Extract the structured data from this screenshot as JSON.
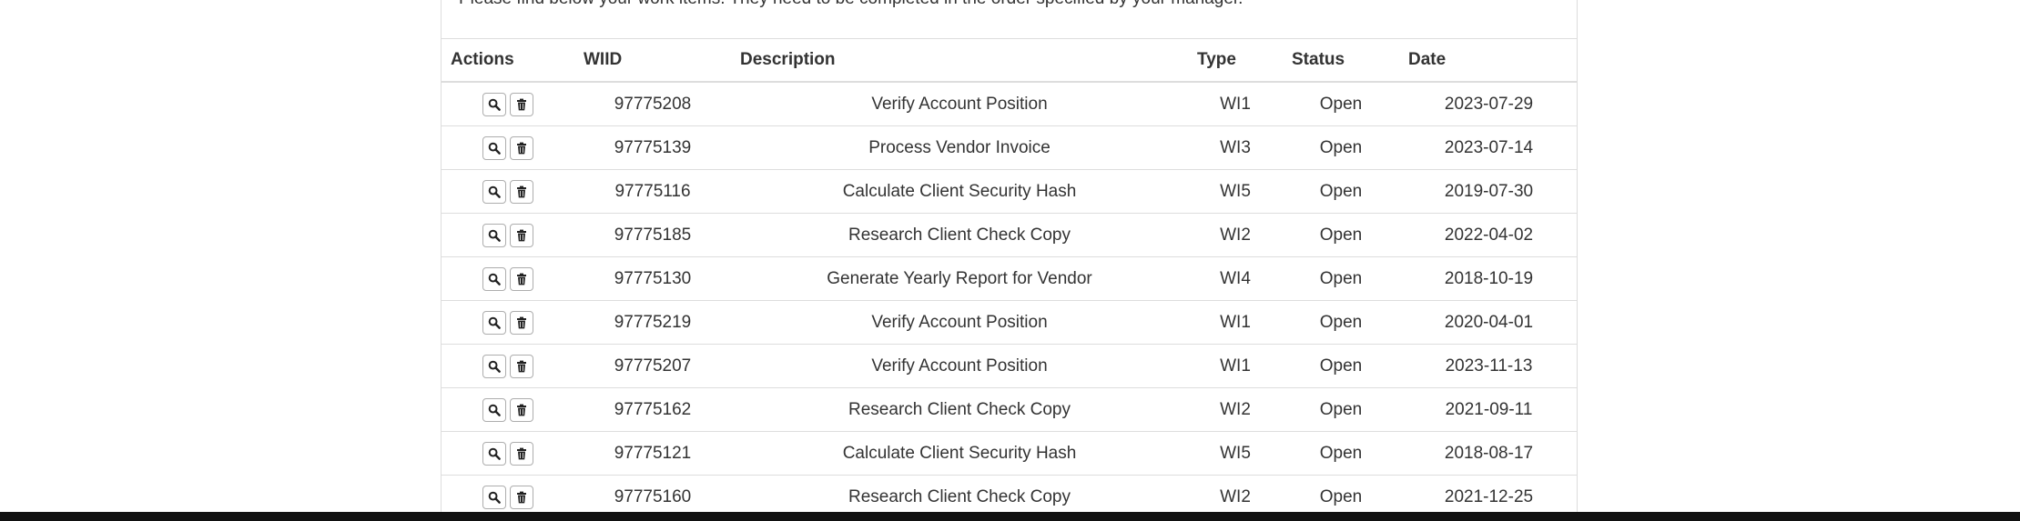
{
  "intro": {
    "text": "Please find below your work items. They need to be completed in the order specified by your manager."
  },
  "table": {
    "headers": {
      "actions": "Actions",
      "wiid": "WIID",
      "description": "Description",
      "type": "Type",
      "status": "Status",
      "date": "Date"
    },
    "rows": [
      {
        "wiid": "97775208",
        "description": "Verify Account Position",
        "type": "WI1",
        "status": "Open",
        "date": "2023-07-29"
      },
      {
        "wiid": "97775139",
        "description": "Process Vendor Invoice",
        "type": "WI3",
        "status": "Open",
        "date": "2023-07-14"
      },
      {
        "wiid": "97775116",
        "description": "Calculate Client Security Hash",
        "type": "WI5",
        "status": "Open",
        "date": "2019-07-30"
      },
      {
        "wiid": "97775185",
        "description": "Research Client Check Copy",
        "type": "WI2",
        "status": "Open",
        "date": "2022-04-02"
      },
      {
        "wiid": "97775130",
        "description": "Generate Yearly Report for Vendor",
        "type": "WI4",
        "status": "Open",
        "date": "2018-10-19"
      },
      {
        "wiid": "97775219",
        "description": "Verify Account Position",
        "type": "WI1",
        "status": "Open",
        "date": "2020-04-01"
      },
      {
        "wiid": "97775207",
        "description": "Verify Account Position",
        "type": "WI1",
        "status": "Open",
        "date": "2023-11-13"
      },
      {
        "wiid": "97775162",
        "description": "Research Client Check Copy",
        "type": "WI2",
        "status": "Open",
        "date": "2021-09-11"
      },
      {
        "wiid": "97775121",
        "description": "Calculate Client Security Hash",
        "type": "WI5",
        "status": "Open",
        "date": "2018-08-17"
      },
      {
        "wiid": "97775160",
        "description": "Research Client Check Copy",
        "type": "WI2",
        "status": "Open",
        "date": "2021-12-25"
      }
    ]
  },
  "icons": {
    "view": "search-icon",
    "delete": "trash-icon"
  }
}
